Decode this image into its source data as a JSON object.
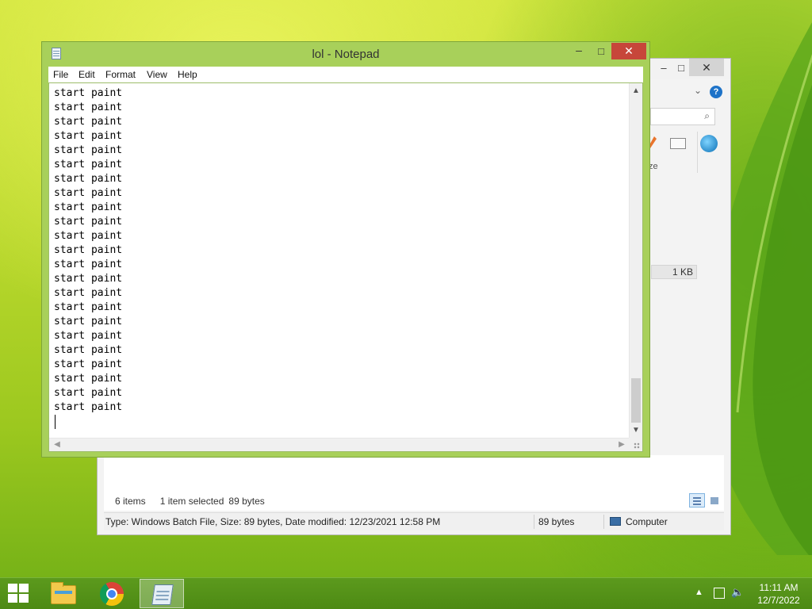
{
  "desktop": {
    "colors": {
      "wallpaper": "#b4d52a",
      "leaf": "#4f9a16"
    }
  },
  "explorer": {
    "window_controls": {
      "minimize": "–",
      "maximize": "□",
      "close": "✕"
    },
    "help_label": "?",
    "size_value": "1 KB",
    "column_header_fragment": "ze",
    "items_count": "6 items",
    "selected_info": "1 item selected",
    "selected_size": "89 bytes",
    "status": {
      "details": "Type: Windows Batch File, Size: 89 bytes, Date modified: 12/23/2021 12:58 PM",
      "size": "89 bytes",
      "location": "Computer"
    }
  },
  "notepad": {
    "title": "lol - Notepad",
    "controls": {
      "minimize": "–",
      "maximize": "□",
      "close": "✕"
    },
    "menu": [
      "File",
      "Edit",
      "Format",
      "View",
      "Help"
    ],
    "content_lines": [
      "start paint",
      "start paint",
      "start paint",
      "start paint",
      "start paint",
      "start paint",
      "start paint",
      "start paint",
      "start paint",
      "start paint",
      "start paint",
      "start paint",
      "start paint",
      "start paint",
      "start paint",
      "start paint",
      "start paint",
      "start paint",
      "start paint",
      "start paint",
      "start paint",
      "start paint",
      "start paint"
    ],
    "colors": {
      "frame": "#a8d05a",
      "close": "#c7463a"
    }
  },
  "taskbar": {
    "apps": [
      {
        "name": "File Explorer",
        "icon": "folder-icon"
      },
      {
        "name": "Google Chrome",
        "icon": "chrome-icon"
      },
      {
        "name": "Notepad",
        "icon": "notepad-icon",
        "active": true
      }
    ],
    "tray_chevron": "▲",
    "time": "11:11 AM",
    "date": "12/7/2022"
  }
}
